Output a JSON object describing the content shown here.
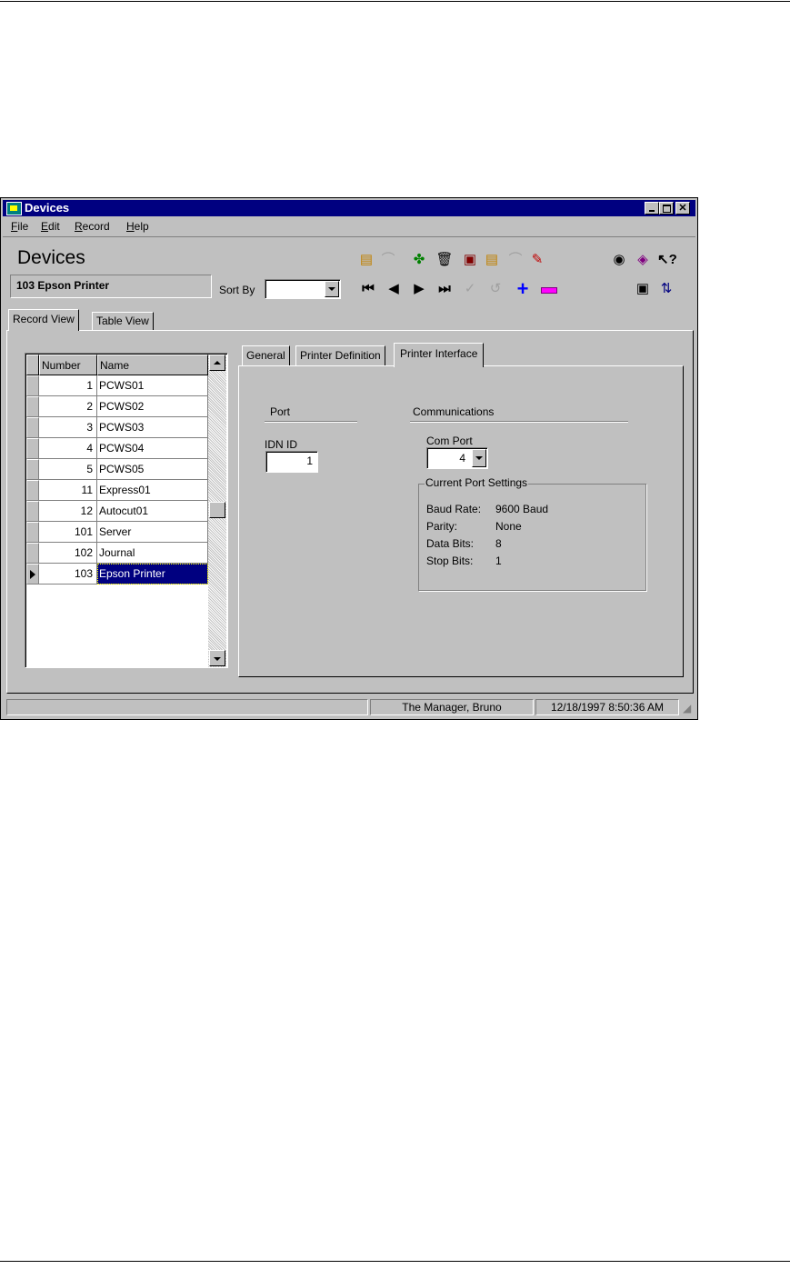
{
  "window": {
    "title": "Devices"
  },
  "menu": [
    {
      "label": "File",
      "key": "F",
      "rest": "ile"
    },
    {
      "label": "Edit",
      "key": "E",
      "rest": "dit"
    },
    {
      "label": "Record",
      "key": "R",
      "rest": "ecord"
    },
    {
      "label": "Help",
      "key": "H",
      "rest": "elp"
    }
  ],
  "header": {
    "title": "Devices",
    "current_record": "103 Epson Printer",
    "sort_by_label": "Sort By",
    "sort_by_value": ""
  },
  "main_tabs": [
    {
      "label": "Record View"
    },
    {
      "label": "Table View"
    }
  ],
  "grid": {
    "columns": [
      "Number",
      "Name"
    ],
    "rows": [
      {
        "number": "1",
        "name": "PCWS01"
      },
      {
        "number": "2",
        "name": "PCWS02"
      },
      {
        "number": "3",
        "name": "PCWS03"
      },
      {
        "number": "4",
        "name": "PCWS04"
      },
      {
        "number": "5",
        "name": "PCWS05"
      },
      {
        "number": "11",
        "name": "Express01"
      },
      {
        "number": "12",
        "name": "Autocut01"
      },
      {
        "number": "101",
        "name": "Server"
      },
      {
        "number": "102",
        "name": "Journal"
      },
      {
        "number": "103",
        "name": "Epson Printer"
      }
    ],
    "selected_index": 9
  },
  "detail_tabs": [
    {
      "label": "General"
    },
    {
      "label": "Printer Definition"
    },
    {
      "label": "Printer Interface"
    }
  ],
  "port": {
    "section_label": "Port",
    "idn_label": "IDN ID",
    "idn_value": "1"
  },
  "communications": {
    "section_label": "Communications",
    "com_port_label": "Com Port",
    "com_port_value": "4",
    "settings_title": "Current Port Settings",
    "settings": [
      {
        "label": "Baud Rate:",
        "value": "9600 Baud"
      },
      {
        "label": "Parity:",
        "value": "None"
      },
      {
        "label": "Data Bits:",
        "value": "8"
      },
      {
        "label": "Stop Bits:",
        "value": "1"
      }
    ]
  },
  "status": {
    "user": "The Manager, Bruno",
    "datetime": "12/18/1997 8:50:36 AM"
  },
  "colors": {
    "titlebar": "#000080",
    "window": "#c0c0c0",
    "selection": "#000080",
    "add": "#0000ff",
    "remove": "#ff00ff"
  }
}
